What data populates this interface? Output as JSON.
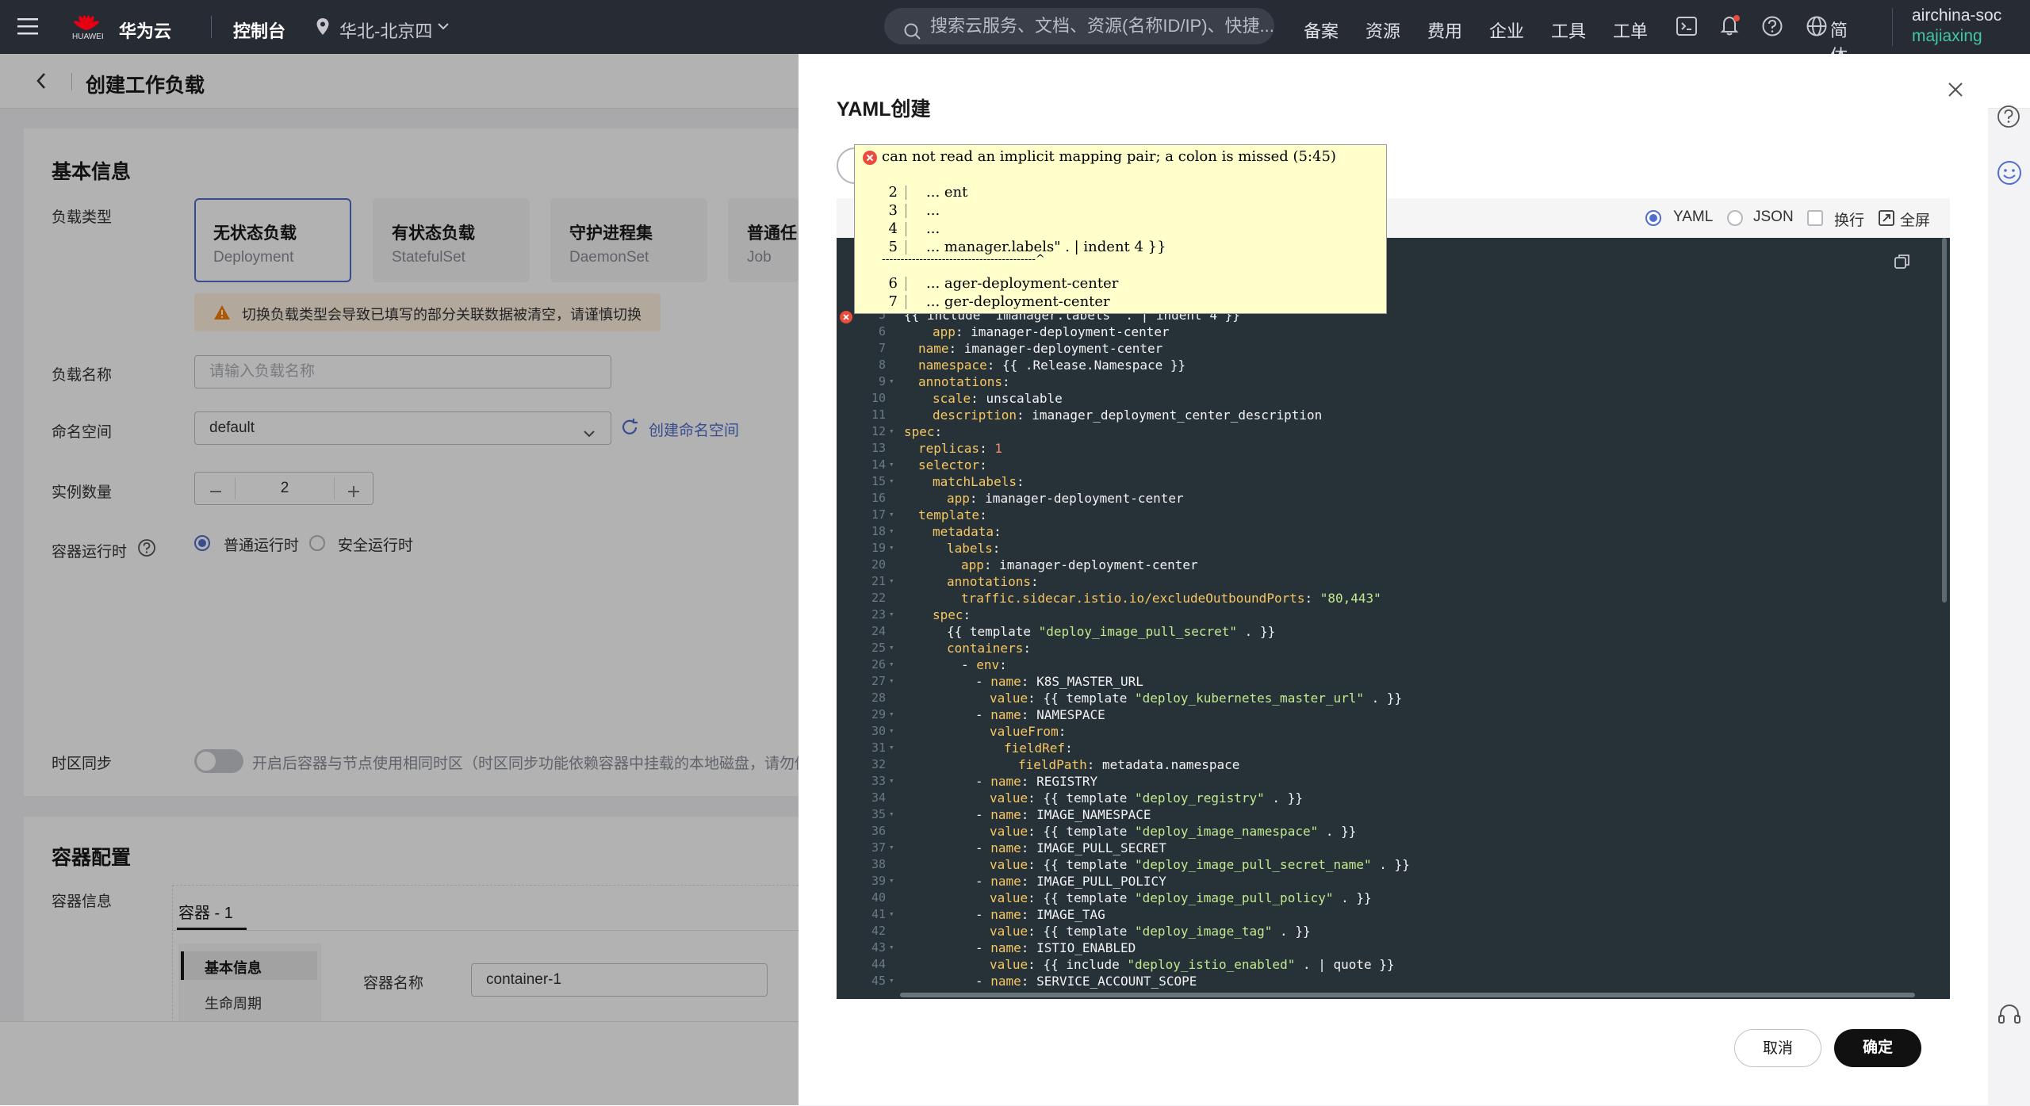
{
  "topbar": {
    "brand": "华为云",
    "logo_text": "HUAWEI",
    "console": "控制台",
    "region": "华北-北京四",
    "search_placeholder": "搜索云服务、文档、资源(名称ID/IP)、快捷...",
    "nav": [
      "备案",
      "资源",
      "费用",
      "企业",
      "工具",
      "工单"
    ],
    "lang": "简体",
    "account": "airchina-soc",
    "user": "majiaxing"
  },
  "page": {
    "title": "创建工作负载",
    "basic_info_title": "基本信息",
    "workload_type_label": "负载类型",
    "workload_types": [
      {
        "name": "无状态负载",
        "sub": "Deployment"
      },
      {
        "name": "有状态负载",
        "sub": "StatefulSet"
      },
      {
        "name": "守护进程集",
        "sub": "DaemonSet"
      },
      {
        "name": "普通任",
        "sub": "Job"
      }
    ],
    "warning": "切换负载类型会导致已填写的部分关联数据被清空，请谨慎切换",
    "name_label": "负载名称",
    "name_placeholder": "请输入负载名称",
    "namespace_label": "命名空间",
    "namespace_value": "default",
    "create_namespace": "创建命名空间",
    "replicas_label": "实例数量",
    "replicas_value": "2",
    "runtime_label": "容器运行时",
    "runtime_options": [
      "普通运行时",
      "安全运行时"
    ],
    "timezone_label": "时区同步",
    "timezone_desc": "开启后容器与节点使用相同时区（时区同步功能依赖容器中挂载的本地磁盘，请勿修改",
    "container_config_title": "容器配置",
    "container_info_label": "容器信息",
    "container_tab": "容器 - 1",
    "side_menu": [
      "基本信息",
      "生命周期"
    ],
    "container_name_label": "容器名称",
    "container_name_value": "container-1"
  },
  "dialog": {
    "title": "YAML创建",
    "format_options": [
      "YAML",
      "JSON"
    ],
    "wrap_label": "换行",
    "fullscreen_label": "全屏",
    "cancel": "取消",
    "confirm": "确定"
  },
  "tooltip": {
    "message": "can not read an implicit mapping pair; a colon is missed (5:45)",
    "lines": [
      {
        "no": "2",
        "text": "... ent"
      },
      {
        "no": "3",
        "text": "..."
      },
      {
        "no": "4",
        "text": "..."
      },
      {
        "no": "5",
        "text": "... manager.labels\" . | indent 4 }}"
      },
      {
        "no": "6",
        "text": "... ager-deployment-center"
      },
      {
        "no": "7",
        "text": "... ger-deployment-center"
      }
    ],
    "underline": "-----------------------------------------^"
  },
  "editor": {
    "lines": [
      {
        "no": "5",
        "fold": false,
        "indent": 0,
        "parts": [
          [
            "v",
            "{{ include  imanager.labels  . | indent 4 }}"
          ]
        ]
      },
      {
        "no": "6",
        "fold": false,
        "indent": 2,
        "parts": [
          [
            "k",
            "app"
          ],
          [
            "v",
            ": imanager-deployment-center"
          ]
        ]
      },
      {
        "no": "7",
        "fold": false,
        "indent": 1,
        "parts": [
          [
            "k",
            "name"
          ],
          [
            "v",
            ": imanager-deployment-center"
          ]
        ]
      },
      {
        "no": "8",
        "fold": false,
        "indent": 1,
        "parts": [
          [
            "k",
            "namespace"
          ],
          [
            "v",
            ": {{ .Release.Namespace }}"
          ]
        ]
      },
      {
        "no": "9",
        "fold": true,
        "indent": 1,
        "parts": [
          [
            "k",
            "annotations"
          ],
          [
            "v",
            ":"
          ]
        ]
      },
      {
        "no": "10",
        "fold": false,
        "indent": 2,
        "parts": [
          [
            "k",
            "scale"
          ],
          [
            "v",
            ": unscalable"
          ]
        ]
      },
      {
        "no": "11",
        "fold": false,
        "indent": 2,
        "parts": [
          [
            "k",
            "description"
          ],
          [
            "v",
            ": imanager_deployment_center_description"
          ]
        ]
      },
      {
        "no": "12",
        "fold": true,
        "indent": 0,
        "parts": [
          [
            "k",
            "spec"
          ],
          [
            "v",
            ":"
          ]
        ]
      },
      {
        "no": "13",
        "fold": false,
        "indent": 1,
        "parts": [
          [
            "k",
            "replicas"
          ],
          [
            "v",
            ": "
          ],
          [
            "n",
            "1"
          ]
        ]
      },
      {
        "no": "14",
        "fold": true,
        "indent": 1,
        "parts": [
          [
            "k",
            "selector"
          ],
          [
            "v",
            ":"
          ]
        ]
      },
      {
        "no": "15",
        "fold": true,
        "indent": 2,
        "parts": [
          [
            "k",
            "matchLabels"
          ],
          [
            "v",
            ":"
          ]
        ]
      },
      {
        "no": "16",
        "fold": false,
        "indent": 3,
        "parts": [
          [
            "k",
            "app"
          ],
          [
            "v",
            ": imanager-deployment-center"
          ]
        ]
      },
      {
        "no": "17",
        "fold": true,
        "indent": 1,
        "parts": [
          [
            "k",
            "template"
          ],
          [
            "v",
            ":"
          ]
        ]
      },
      {
        "no": "18",
        "fold": true,
        "indent": 2,
        "parts": [
          [
            "k",
            "metadata"
          ],
          [
            "v",
            ":"
          ]
        ]
      },
      {
        "no": "19",
        "fold": true,
        "indent": 3,
        "parts": [
          [
            "k",
            "labels"
          ],
          [
            "v",
            ":"
          ]
        ]
      },
      {
        "no": "20",
        "fold": false,
        "indent": 4,
        "parts": [
          [
            "k",
            "app"
          ],
          [
            "v",
            ": imanager-deployment-center"
          ]
        ]
      },
      {
        "no": "21",
        "fold": true,
        "indent": 3,
        "parts": [
          [
            "k",
            "annotations"
          ],
          [
            "v",
            ":"
          ]
        ]
      },
      {
        "no": "22",
        "fold": false,
        "indent": 4,
        "parts": [
          [
            "k",
            "traffic.sidecar.istio.io/excludeOutboundPorts"
          ],
          [
            "v",
            ": "
          ],
          [
            "s",
            "\"80,443\""
          ]
        ]
      },
      {
        "no": "23",
        "fold": true,
        "indent": 2,
        "parts": [
          [
            "k",
            "spec"
          ],
          [
            "v",
            ":"
          ]
        ]
      },
      {
        "no": "24",
        "fold": false,
        "indent": 3,
        "parts": [
          [
            "v",
            "{{ template "
          ],
          [
            "s",
            "\"deploy_image_pull_secret\""
          ],
          [
            "v",
            " . }}"
          ]
        ]
      },
      {
        "no": "25",
        "fold": true,
        "indent": 3,
        "parts": [
          [
            "k",
            "containers"
          ],
          [
            "v",
            ":"
          ]
        ]
      },
      {
        "no": "26",
        "fold": true,
        "indent": 4,
        "parts": [
          [
            "v",
            "- "
          ],
          [
            "k",
            "env"
          ],
          [
            "v",
            ":"
          ]
        ]
      },
      {
        "no": "27",
        "fold": true,
        "indent": 5,
        "parts": [
          [
            "v",
            "- "
          ],
          [
            "k",
            "name"
          ],
          [
            "v",
            ": K8S_MASTER_URL"
          ]
        ]
      },
      {
        "no": "28",
        "fold": false,
        "indent": 6,
        "parts": [
          [
            "k",
            "value"
          ],
          [
            "v",
            ": {{ template "
          ],
          [
            "s",
            "\"deploy_kubernetes_master_url\""
          ],
          [
            "v",
            " . }}"
          ]
        ]
      },
      {
        "no": "29",
        "fold": true,
        "indent": 5,
        "parts": [
          [
            "v",
            "- "
          ],
          [
            "k",
            "name"
          ],
          [
            "v",
            ": NAMESPACE"
          ]
        ]
      },
      {
        "no": "30",
        "fold": true,
        "indent": 6,
        "parts": [
          [
            "k",
            "valueFrom"
          ],
          [
            "v",
            ":"
          ]
        ]
      },
      {
        "no": "31",
        "fold": true,
        "indent": 7,
        "parts": [
          [
            "k",
            "fieldRef"
          ],
          [
            "v",
            ":"
          ]
        ]
      },
      {
        "no": "32",
        "fold": false,
        "indent": 8,
        "parts": [
          [
            "k",
            "fieldPath"
          ],
          [
            "v",
            ": metadata.namespace"
          ]
        ]
      },
      {
        "no": "33",
        "fold": true,
        "indent": 5,
        "parts": [
          [
            "v",
            "- "
          ],
          [
            "k",
            "name"
          ],
          [
            "v",
            ": REGISTRY"
          ]
        ]
      },
      {
        "no": "34",
        "fold": false,
        "indent": 6,
        "parts": [
          [
            "k",
            "value"
          ],
          [
            "v",
            ": {{ template "
          ],
          [
            "s",
            "\"deploy_registry\""
          ],
          [
            "v",
            " . }}"
          ]
        ]
      },
      {
        "no": "35",
        "fold": true,
        "indent": 5,
        "parts": [
          [
            "v",
            "- "
          ],
          [
            "k",
            "name"
          ],
          [
            "v",
            ": IMAGE_NAMESPACE"
          ]
        ]
      },
      {
        "no": "36",
        "fold": false,
        "indent": 6,
        "parts": [
          [
            "k",
            "value"
          ],
          [
            "v",
            ": {{ template "
          ],
          [
            "s",
            "\"deploy_image_namespace\""
          ],
          [
            "v",
            " . }}"
          ]
        ]
      },
      {
        "no": "37",
        "fold": true,
        "indent": 5,
        "parts": [
          [
            "v",
            "- "
          ],
          [
            "k",
            "name"
          ],
          [
            "v",
            ": IMAGE_PULL_SECRET"
          ]
        ]
      },
      {
        "no": "38",
        "fold": false,
        "indent": 6,
        "parts": [
          [
            "k",
            "value"
          ],
          [
            "v",
            ": {{ template "
          ],
          [
            "s",
            "\"deploy_image_pull_secret_name\""
          ],
          [
            "v",
            " . }}"
          ]
        ]
      },
      {
        "no": "39",
        "fold": true,
        "indent": 5,
        "parts": [
          [
            "v",
            "- "
          ],
          [
            "k",
            "name"
          ],
          [
            "v",
            ": IMAGE_PULL_POLICY"
          ]
        ]
      },
      {
        "no": "40",
        "fold": false,
        "indent": 6,
        "parts": [
          [
            "k",
            "value"
          ],
          [
            "v",
            ": {{ template "
          ],
          [
            "s",
            "\"deploy_image_pull_policy\""
          ],
          [
            "v",
            " . }}"
          ]
        ]
      },
      {
        "no": "41",
        "fold": true,
        "indent": 5,
        "parts": [
          [
            "v",
            "- "
          ],
          [
            "k",
            "name"
          ],
          [
            "v",
            ": IMAGE_TAG"
          ]
        ]
      },
      {
        "no": "42",
        "fold": false,
        "indent": 6,
        "parts": [
          [
            "k",
            "value"
          ],
          [
            "v",
            ": {{ template "
          ],
          [
            "s",
            "\"deploy_image_tag\""
          ],
          [
            "v",
            " . }}"
          ]
        ]
      },
      {
        "no": "43",
        "fold": true,
        "indent": 5,
        "parts": [
          [
            "v",
            "- "
          ],
          [
            "k",
            "name"
          ],
          [
            "v",
            ": ISTIO_ENABLED"
          ]
        ]
      },
      {
        "no": "44",
        "fold": false,
        "indent": 6,
        "parts": [
          [
            "k",
            "value"
          ],
          [
            "v",
            ": {{ include "
          ],
          [
            "s",
            "\"deploy_istio_enabled\""
          ],
          [
            "v",
            " . | quote }}"
          ]
        ]
      },
      {
        "no": "45",
        "fold": true,
        "indent": 5,
        "parts": [
          [
            "v",
            "- "
          ],
          [
            "k",
            "name"
          ],
          [
            "v",
            ": SERVICE_ACCOUNT_SCOPE"
          ]
        ]
      }
    ]
  }
}
